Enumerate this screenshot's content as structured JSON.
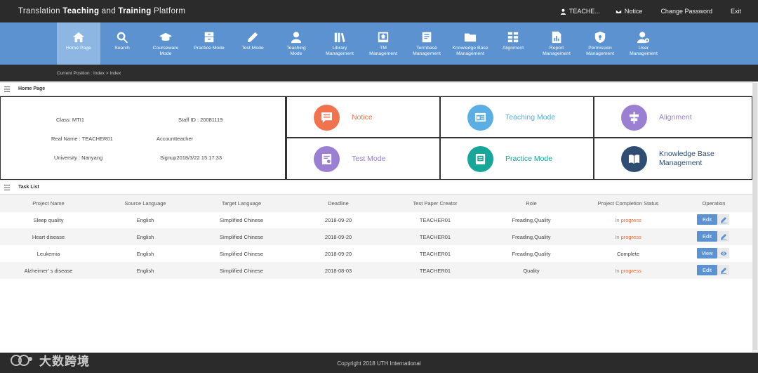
{
  "app": {
    "title_prefix": "Translation",
    "title_bold1": "Teaching",
    "title_mid": "and",
    "title_bold2": "Training",
    "title_suffix": "Platform"
  },
  "topbar": {
    "user": "TEACHE...",
    "notice": "Notice",
    "change_password": "Change Password",
    "exit": "Exit"
  },
  "nav": [
    {
      "label": "Home Page",
      "icon": "home-icon",
      "active": true
    },
    {
      "label": "Search",
      "icon": "search-icon"
    },
    {
      "label": "Courseware\nMode",
      "icon": "graduation-cap-icon"
    },
    {
      "label": "Practice Mode",
      "icon": "archive-icon"
    },
    {
      "label": "Test Mode",
      "icon": "pencil-icon"
    },
    {
      "label": "Teaching\nMode",
      "icon": "user-icon"
    },
    {
      "label": "Library\nManagement",
      "icon": "library-icon"
    },
    {
      "label": "TM\nManagement",
      "icon": "tm-icon"
    },
    {
      "label": "Termbase\nManagement",
      "icon": "book-icon"
    },
    {
      "label": "Knowledge Base\nManagement",
      "icon": "folder-icon"
    },
    {
      "label": "Alignment",
      "icon": "grid-icon"
    },
    {
      "label": "Report\nManagement",
      "icon": "report-icon"
    },
    {
      "label": "Permission\nManagement",
      "icon": "shield-icon"
    },
    {
      "label": "User\nManagement",
      "icon": "user-gear-icon"
    }
  ],
  "breadcrumb": "Current Position : Index   >  Index",
  "home_panel": {
    "title": "Home Page",
    "class": "Class: MTI1",
    "staff_id": "Staff ID : 20081119",
    "real_name": "Real Name : TEACHER01",
    "account": "Accountteacher",
    "university": "University : Nanyang",
    "signup": "Signup2018/3/22 15:17:33"
  },
  "tiles": [
    {
      "label": "Notice",
      "color": "#f0734e",
      "icon": "message-icon"
    },
    {
      "label": "Teaching Mode",
      "color": "#5aaee3",
      "icon": "teaching-icon"
    },
    {
      "label": "Alignment",
      "color": "#9b7fd3",
      "icon": "align-icon"
    },
    {
      "label": "Test Mode",
      "color": "#9b7fd3",
      "icon": "test-icon"
    },
    {
      "label": "Practice Mode",
      "color": "#16a69a",
      "icon": "practice-icon"
    },
    {
      "label": "Knowledge Base Management",
      "color": "#2f4d73",
      "icon": "open-book-icon"
    }
  ],
  "task_panel": {
    "title": "Task List",
    "columns": [
      "Project Name",
      "Source Language",
      "Target Language",
      "Deadline",
      "Test Paper Creator",
      "Role",
      "Project Completion Status",
      "Operation"
    ],
    "rows": [
      {
        "name": "Sleep quality",
        "source": "English",
        "target": "Simplified Chinese",
        "deadline": "2018-09-20",
        "creator": "TEACHER01",
        "role": "Freading,Quality",
        "status": "In progress",
        "op": "Edit"
      },
      {
        "name": "Heart disease",
        "source": "English",
        "target": "Simplified Chinese",
        "deadline": "2018-09-20",
        "creator": "TEACHER01",
        "role": "Freading,Quality",
        "status": "In progress",
        "op": "Edit"
      },
      {
        "name": "Leukemia",
        "source": "English",
        "target": "Simplified Chinese",
        "deadline": "2018-09-20",
        "creator": "TEACHER01",
        "role": "Freading,Quality",
        "status": "Complete",
        "op": "View"
      },
      {
        "name": "Alzheimer’ s disease",
        "source": "English",
        "target": "Simplified Chinese",
        "deadline": "2018-08-03",
        "creator": "TEACHER01",
        "role": "Quality",
        "status": "In progress",
        "op": "Edit"
      }
    ]
  },
  "footer": {
    "copyright": "Copyright 2018 UTH International",
    "watermark": "大数跨境"
  },
  "colors": {
    "nav": "#5b92cf",
    "nav_active": "#8db6e3",
    "in_progress": "#f06a3b",
    "dark_bar": "#2b2b2b"
  }
}
